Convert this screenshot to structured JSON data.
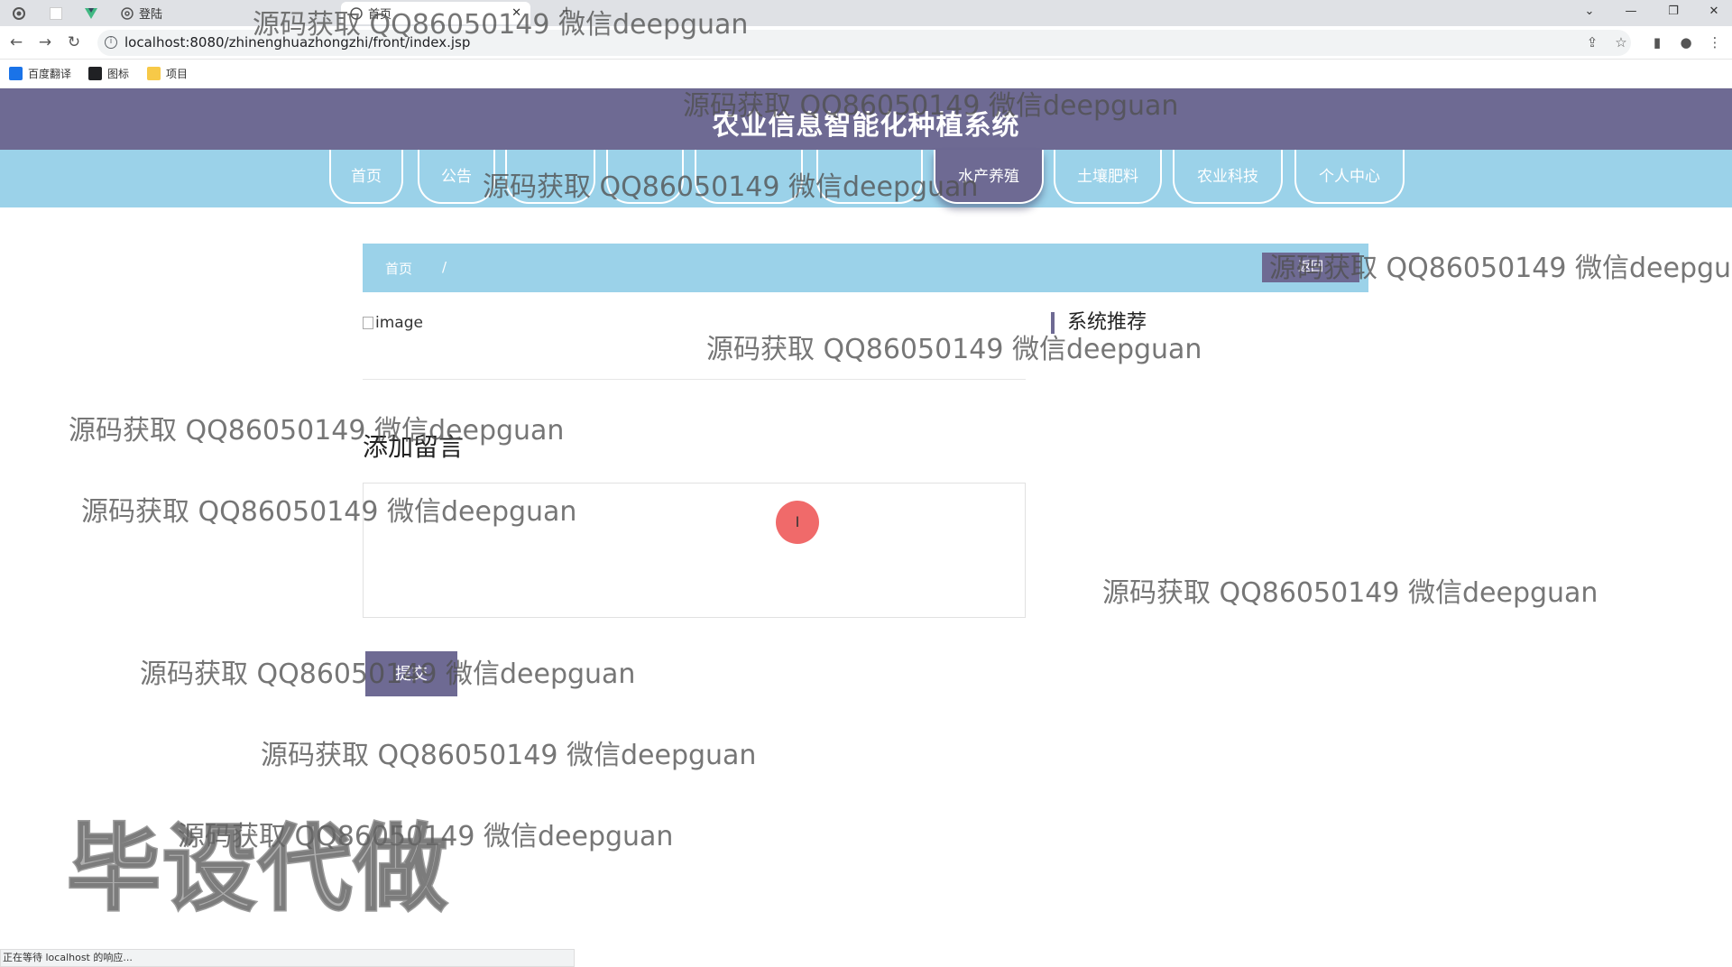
{
  "browser": {
    "tabs": [
      {
        "label": "",
        "icon": "chrome-icon"
      },
      {
        "label": "",
        "icon": "blank-tab-icon"
      },
      {
        "label": "",
        "icon": "vue-icon"
      },
      {
        "label": "登陆",
        "icon": "globe-icon"
      },
      {
        "label": "首页",
        "icon": "globe-icon"
      }
    ],
    "url": "localhost:8080/zhinenghuazhongzhi/front/index.jsp",
    "bookmarks": [
      {
        "label": "百度翻译",
        "icon": "translate-icon",
        "color": "#1a73e8"
      },
      {
        "label": "图标",
        "icon": "icon-folder-icon",
        "color": "#202124"
      },
      {
        "label": "项目",
        "icon": "folder-icon",
        "color": "#f7c948"
      }
    ],
    "status": "正在等待 localhost 的响应..."
  },
  "site": {
    "title": "农业信息智能化种植系统",
    "nav": [
      "首页",
      "公告",
      "",
      "",
      "",
      "水产养殖",
      "土壤肥料",
      "农业科技",
      "个人中心"
    ],
    "active_nav": "水产养殖"
  },
  "breadcrumb": {
    "home": "首页",
    "separator": "/",
    "back_button": "返回"
  },
  "content": {
    "image_alt": "image",
    "recommend_title": "系统推荐",
    "add_message_title": "添加留言",
    "message_placeholder": "",
    "submit_label": "提交"
  },
  "watermark": {
    "text": "源码获取 QQ86050149 微信deepguan",
    "big": "毕设代做"
  },
  "colors": {
    "header": "#6e6a93",
    "nav": "#9bd2e9",
    "accent": "#6e6a93"
  }
}
